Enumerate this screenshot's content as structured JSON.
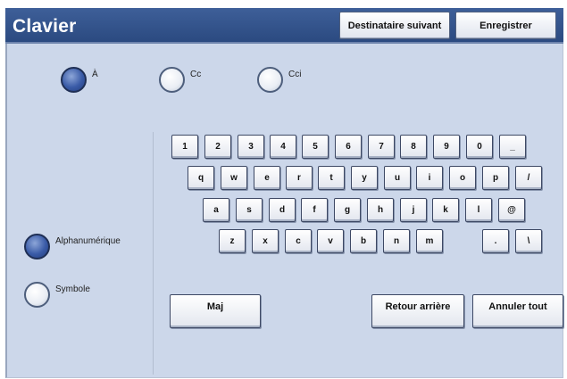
{
  "header": {
    "title": "Clavier",
    "next_recipient_label": "Destinataire suivant",
    "save_label": "Enregistrer"
  },
  "recipient_type": {
    "options": [
      {
        "label": "À",
        "selected": true
      },
      {
        "label": "Cc",
        "selected": false
      },
      {
        "label": "Cci",
        "selected": false
      }
    ]
  },
  "input_mode": {
    "options": [
      {
        "label": "Alphanumérique",
        "selected": true
      },
      {
        "label": "Symbole",
        "selected": false
      }
    ]
  },
  "keyboard": {
    "row1": [
      "1",
      "2",
      "3",
      "4",
      "5",
      "6",
      "7",
      "8",
      "9",
      "0",
      "_"
    ],
    "row2": [
      "q",
      "w",
      "e",
      "r",
      "t",
      "y",
      "u",
      "i",
      "o",
      "p",
      "/"
    ],
    "row3": [
      "a",
      "s",
      "d",
      "f",
      "g",
      "h",
      "j",
      "k",
      "l",
      "@"
    ],
    "row4": [
      "z",
      "x",
      "c",
      "v",
      "b",
      "n",
      "m"
    ],
    "row4_right": [
      ".",
      "\\"
    ]
  },
  "actions": {
    "shift_label": "Maj",
    "backspace_label": "Retour arrière",
    "clear_all_label": "Annuler tout"
  },
  "colors": {
    "titlebar": "#2f4f88",
    "panel": "#ccd7ea",
    "radio_selected": "#3a5ba7"
  }
}
